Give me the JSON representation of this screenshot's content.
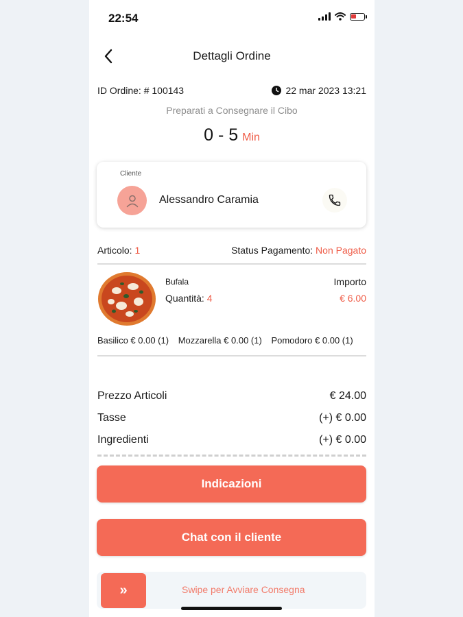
{
  "status_bar": {
    "time": "22:54"
  },
  "nav": {
    "title": "Dettagli Ordine"
  },
  "order": {
    "id_label": "ID Ordine: # 100143",
    "date": "22 mar 2023 13:21",
    "prep_label": "Preparati a Consegnare il Cibo",
    "eta_value": "0 - 5",
    "eta_unit": "Min"
  },
  "customer": {
    "label": "Cliente",
    "name": "Alessandro Caramia"
  },
  "meta": {
    "items_label": "Articolo:",
    "items_count": "1",
    "payment_label": "Status Pagamento:",
    "payment_status": "Non Pagato"
  },
  "item": {
    "name": "Bufala",
    "qty_label": "Quantità:",
    "qty_value": "4",
    "amount_label": "Importo",
    "amount_value": "€ 6.00",
    "ingredients": [
      "Basilico € 0.00 (1)",
      "Mozzarella € 0.00 (1)",
      "Pomodoro € 0.00 (1)"
    ]
  },
  "summary": {
    "items_price_label": "Prezzo Articoli",
    "items_price_value": "€ 24.00",
    "tax_label": "Tasse",
    "tax_value": "(+) € 0.00",
    "ingredients_label": "Ingredienti",
    "ingredients_value": "(+) € 0.00"
  },
  "actions": {
    "directions": "Indicazioni",
    "chat": "Chat con il cliente",
    "swipe_handle": "»",
    "swipe_text": "Swipe per Avviare Consegna"
  },
  "colors": {
    "accent": "#ef5b46",
    "button": "#f46a56",
    "avatar_bg": "#f6a397"
  },
  "icons": [
    "back-arrow-icon",
    "clock-icon",
    "user-icon",
    "phone-icon",
    "wifi-icon",
    "signal-icon",
    "battery-icon",
    "double-chevron-right-icon"
  ]
}
